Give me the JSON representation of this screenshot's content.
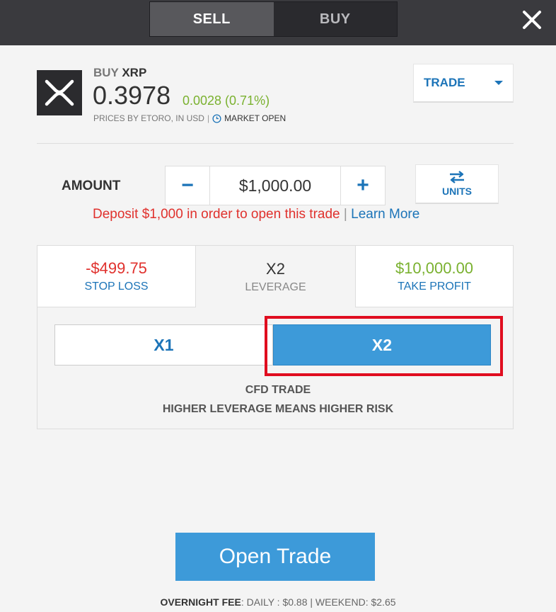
{
  "header": {
    "sell_label": "SELL",
    "buy_label": "BUY"
  },
  "asset": {
    "direction": "BUY",
    "symbol": "XRP",
    "price": "0.3978",
    "change": "0.0028 (0.71%)",
    "prices_by": "PRICES BY ETORO, IN USD",
    "separator": "|",
    "market_status": "MARKET OPEN"
  },
  "trade_dropdown": {
    "label": "TRADE"
  },
  "amount": {
    "label": "AMOUNT",
    "value": "$1,000.00",
    "minus": "−",
    "plus": "+",
    "units_label": "UNITS"
  },
  "deposit": {
    "message": "Deposit $1,000 in order to open this trade",
    "separator": "|",
    "link": "Learn More"
  },
  "panel": {
    "stop_loss": {
      "value": "-$499.75",
      "label": "STOP LOSS"
    },
    "leverage": {
      "value": "X2",
      "label": "LEVERAGE"
    },
    "take_profit": {
      "value": "$10,000.00",
      "label": "TAKE PROFIT"
    },
    "options": [
      "X1",
      "X2"
    ],
    "selected_option": "X2",
    "cfd_line1": "CFD TRADE",
    "cfd_line2": "HIGHER LEVERAGE MEANS HIGHER RISK"
  },
  "open_trade_label": "Open Trade",
  "fee": {
    "label": "OVERNIGHT FEE",
    "details": ": DAILY : $0.88 | WEEKEND: $2.65"
  },
  "colors": {
    "accent_blue": "#1c74b8",
    "button_blue": "#3d9ad9",
    "negative_red": "#e0312d",
    "positive_green": "#7ab12f",
    "highlight_red": "#e00d1f",
    "topbar": "#3a3a3e"
  },
  "icons": [
    "close-icon",
    "xrp-logo-icon",
    "clock-icon",
    "caret-down-icon",
    "swap-icon"
  ]
}
